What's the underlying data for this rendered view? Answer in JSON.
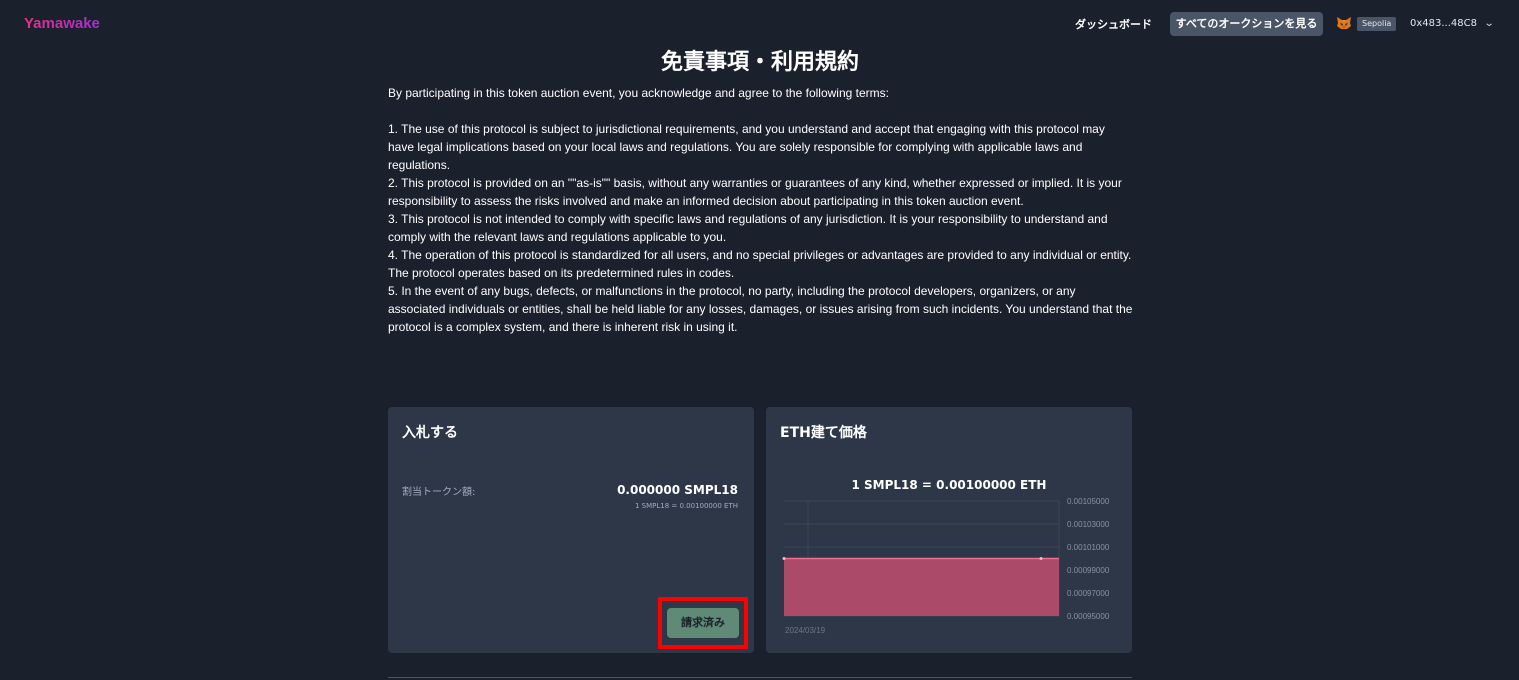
{
  "header": {
    "brand": "Yamawake",
    "nav_dashboard": "ダッシュボード",
    "nav_all_auctions": "すべてのオークションを見る",
    "network": "Sepolia",
    "wallet_address": "0x483...48C8",
    "wallet_icon": "metamask-fox-icon",
    "chevron_icon": "chevron-down-icon"
  },
  "terms": {
    "title": "免責事項・利用規約",
    "intro": "By participating in this token auction event, you acknowledge and agree to the following terms:",
    "items": [
      "1. The use of this protocol is subject to jurisdictional requirements, and you understand and accept that engaging with this protocol may have legal implications based on your local laws and regulations. You are solely responsible for complying with applicable laws and regulations.",
      "2. This protocol is provided on an \"\"as-is\"\" basis, without any warranties or guarantees of any kind, whether expressed or implied. It is your responsibility to assess the risks involved and make an informed decision about participating in this token auction event.",
      "3. This protocol is not intended to comply with specific laws and regulations of any jurisdiction. It is your responsibility to understand and comply with the relevant laws and regulations applicable to you.",
      "4. The operation of this protocol is standardized for all users, and no special privileges or advantages are provided to any individual or entity. The protocol operates based on its predetermined rules in codes.",
      "5. In the event of any bugs, defects, or malfunctions in the protocol, no party, including the protocol developers, organizers, or any associated individuals or entities, shall be held liable for any losses, damages, or issues arising from such incidents. You understand that the protocol is a complex system, and there is inherent risk in using it."
    ]
  },
  "bid_card": {
    "title": "入札する",
    "allocation_label": "割当トークン額:",
    "allocation_value": "0.000000 SMPL18",
    "rate_note": "1 SMPL18 = 0.00100000 ETH",
    "claim_button": "請求済み"
  },
  "price_card": {
    "title": "ETH建て価格",
    "headline": "1 SMPL18 = 0.00100000 ETH"
  },
  "chart_data": {
    "type": "area",
    "x": [
      "2024/03/19",
      "2024/03/19"
    ],
    "values": [
      0.001,
      0.001
    ],
    "x_tick_labels": [
      "2024/03/19"
    ],
    "y_tick_labels": [
      "0.00105000",
      "0.00103000",
      "0.00101000",
      "0.00099000",
      "0.00097000",
      "0.00095000"
    ],
    "ylim": [
      0.00095,
      0.00105
    ],
    "y_axis_side": "right",
    "grid": true,
    "fill_color": "#b34b6b",
    "line_color": "#f56b8f"
  }
}
